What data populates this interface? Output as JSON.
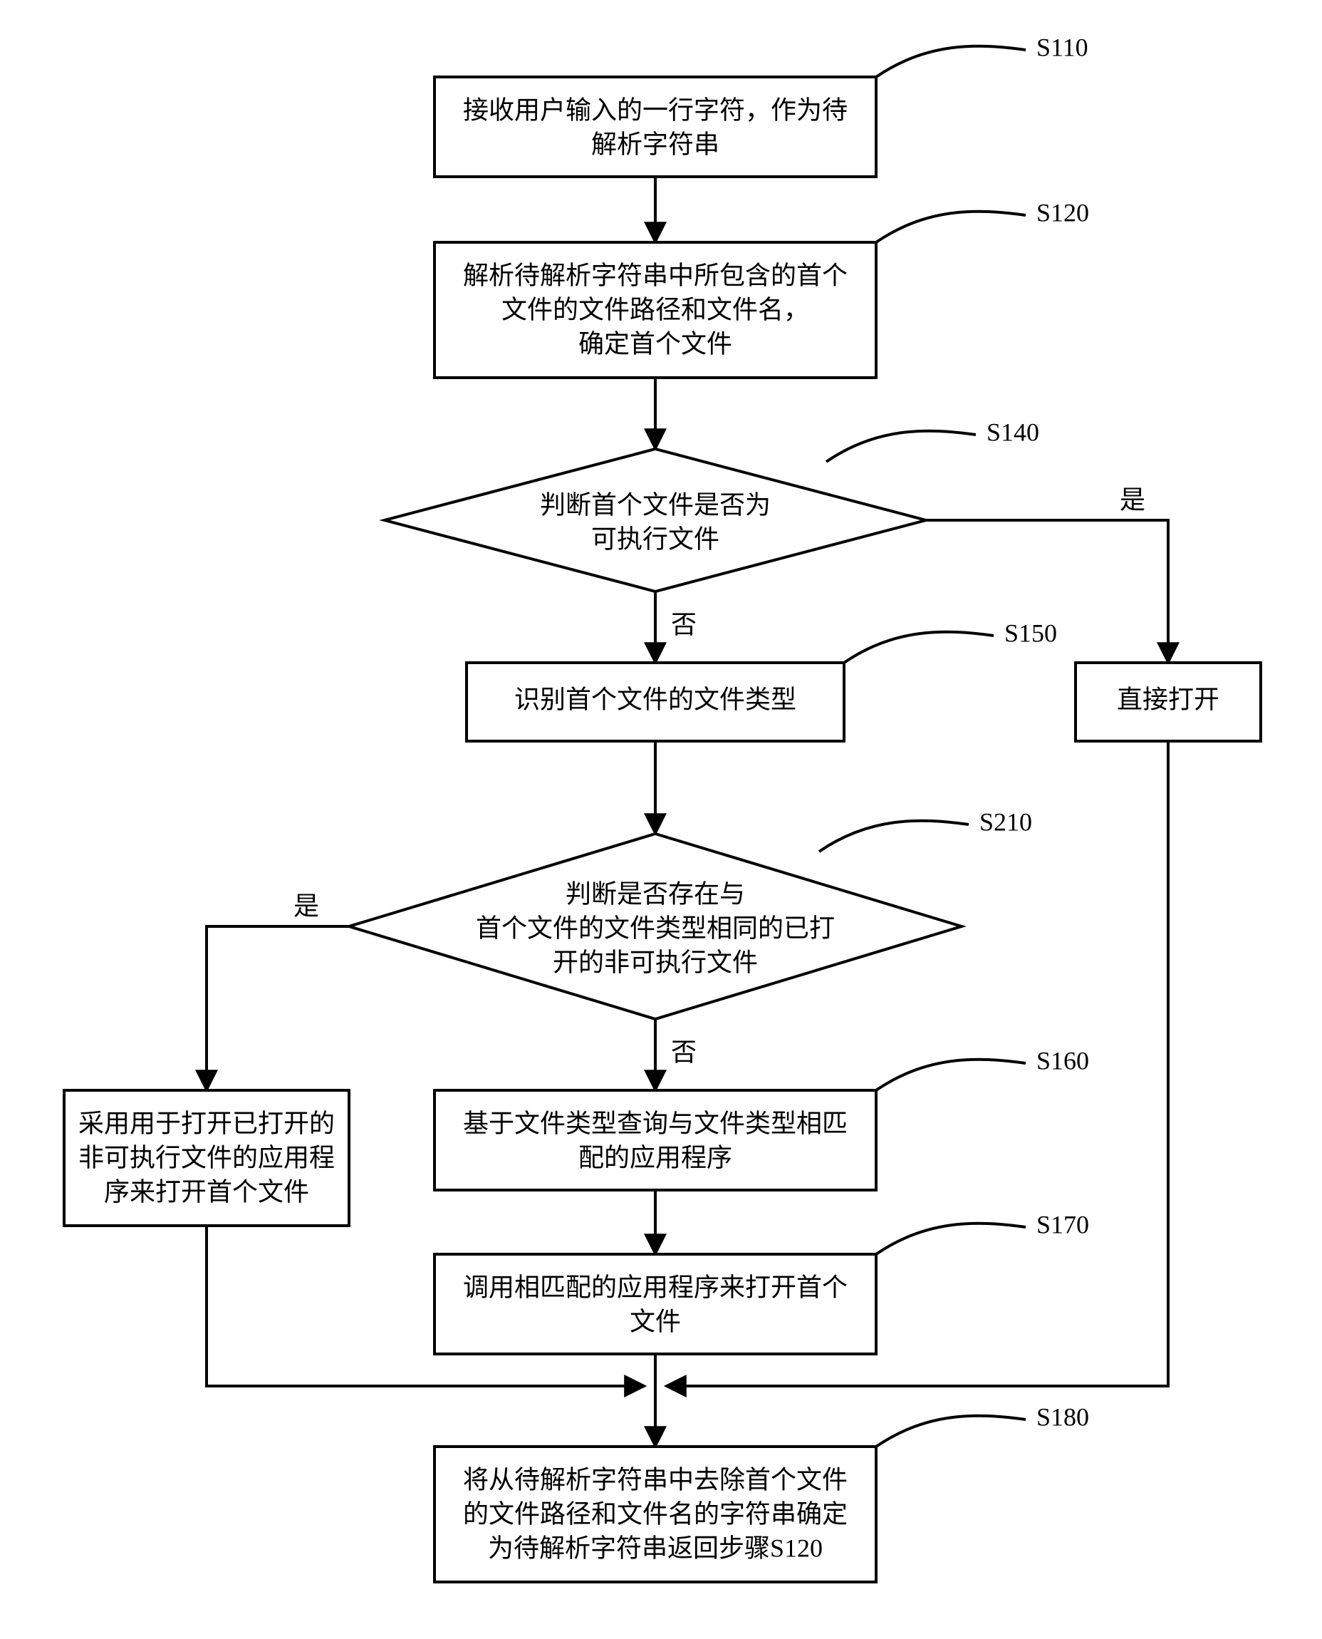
{
  "labels": {
    "s110": "S110",
    "s120": "S120",
    "s140": "S140",
    "s150": "S150",
    "s160": "S160",
    "s170": "S170",
    "s180": "S180",
    "s210": "S210"
  },
  "nodes": {
    "s110": {
      "lines": [
        "接收用户输入的一行字符，作为待",
        "解析字符串"
      ]
    },
    "s120": {
      "lines": [
        "解析待解析字符串中所包含的首个",
        "文件的文件路径和文件名，",
        "确定首个文件"
      ]
    },
    "s140": {
      "lines": [
        "判断首个文件是否为",
        "可执行文件"
      ]
    },
    "s150": {
      "lines": [
        "识别首个文件的文件类型"
      ]
    },
    "openDirect": {
      "lines": [
        "直接打开"
      ]
    },
    "s210": {
      "lines": [
        "判断是否存在与",
        "首个文件的文件类型相同的已打",
        "开的非可执行文件"
      ]
    },
    "useOpened": {
      "lines": [
        "采用用于打开已打开的",
        "非可执行文件的应用程",
        "序来打开首个文件"
      ]
    },
    "s160": {
      "lines": [
        "基于文件类型查询与文件类型相匹",
        "配的应用程序"
      ]
    },
    "s170": {
      "lines": [
        "调用相匹配的应用程序来打开首个",
        "文件"
      ]
    },
    "s180": {
      "lines": [
        "将从待解析字符串中去除首个文件",
        "的文件路径和文件名的字符串确定",
        "为待解析字符串返回步骤S120"
      ]
    }
  },
  "edges": {
    "yes": "是",
    "no": "否"
  }
}
